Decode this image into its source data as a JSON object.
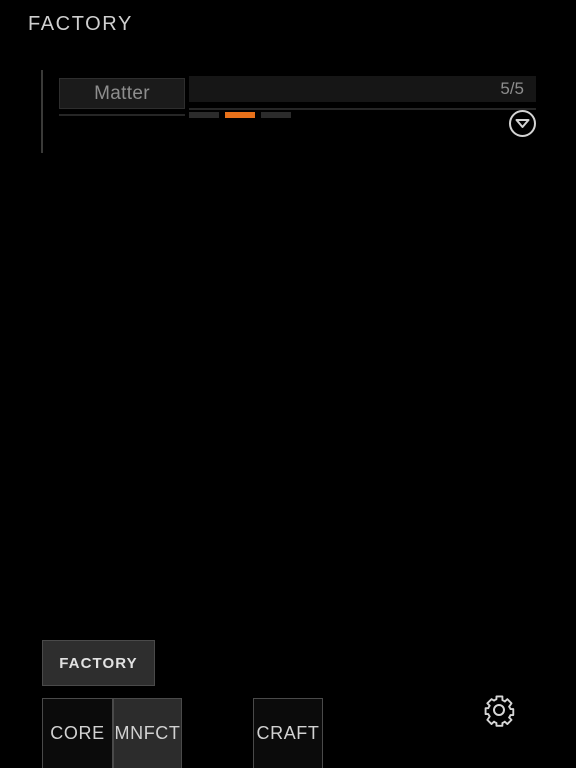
{
  "header": {
    "title": "FACTORY"
  },
  "resource_panel": {
    "resource": {
      "name": "Matter",
      "bar": {
        "value_label": "5/5",
        "current": 5,
        "max": 5,
        "fill_percent": 100,
        "fill_color": "#d8d8d8",
        "text_color": "#8d8d8d"
      },
      "tiers": {
        "count": 3,
        "active_index": 1,
        "active_color": "#e8711a",
        "inactive_color": "#2b2b2b"
      },
      "expand_icon": "chevron-down-circle-icon"
    }
  },
  "bottom_nav": {
    "section": {
      "label": "FACTORY",
      "selected": true
    },
    "tabs": [
      {
        "label": "CORE",
        "selected": false
      },
      {
        "label": "MNFCT",
        "selected": true
      },
      {
        "label": "CRAFT",
        "selected": false
      }
    ],
    "settings_icon": "gear-icon"
  },
  "colors": {
    "background": "#000000",
    "accent": "#e8711a",
    "text": "#cfcfcf",
    "muted_text": "#8e8e8e",
    "panel_border": "#4a4a4a"
  }
}
